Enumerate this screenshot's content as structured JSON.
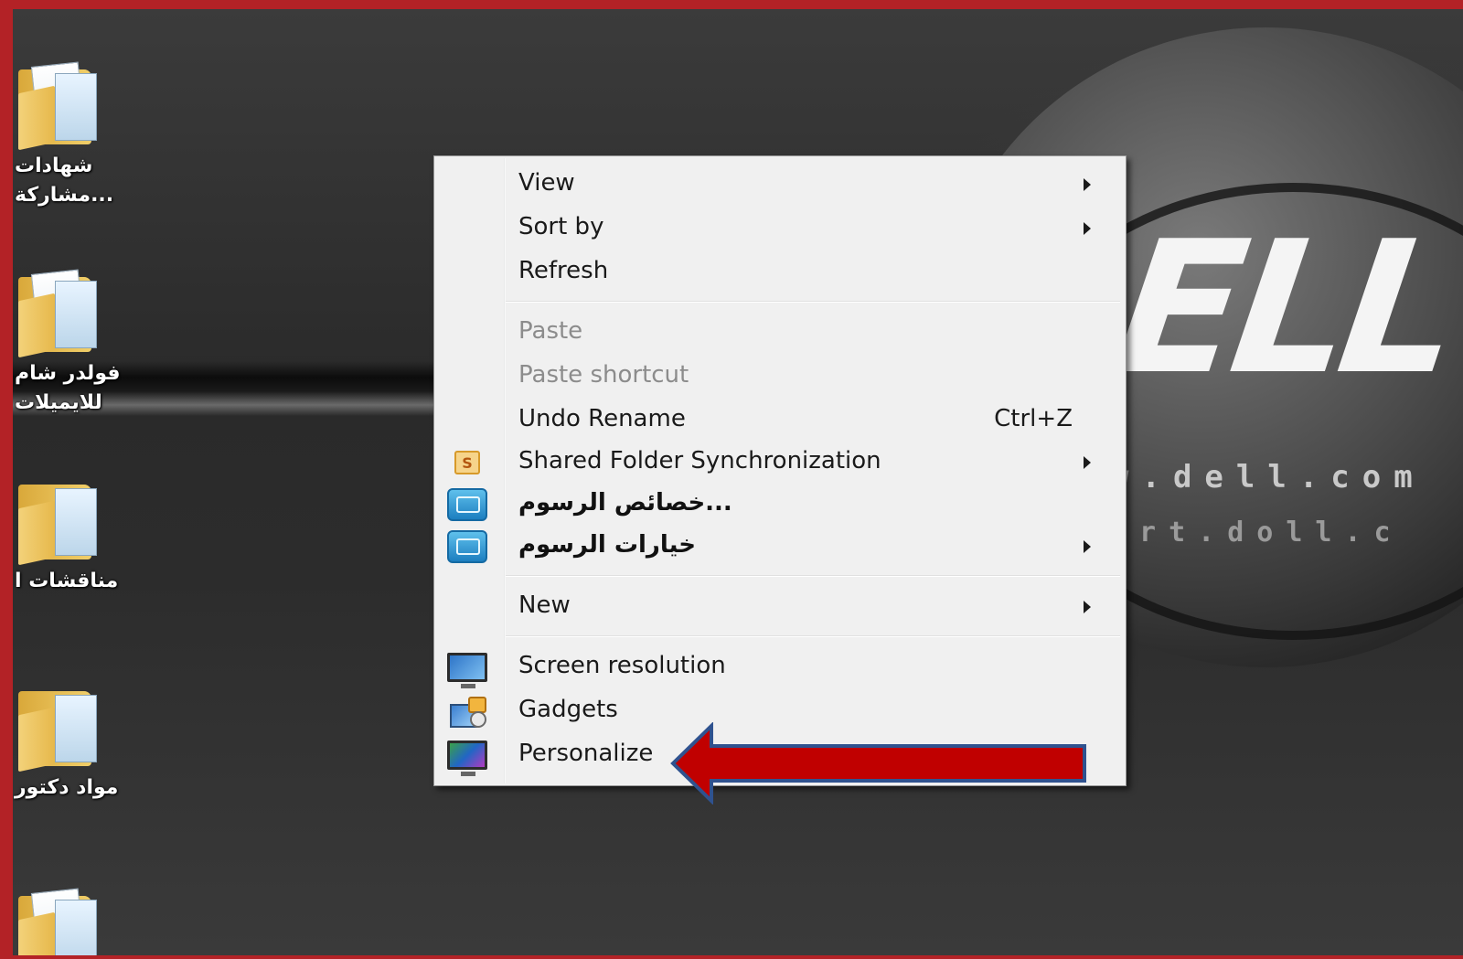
{
  "desktop": {
    "wallpaper": {
      "brand_logo_text": "ELL",
      "url_line_1": "w.dell.com",
      "url_line_2": "ort.doll.c"
    },
    "icons": [
      {
        "label": "شهادات\n...مشاركة"
      },
      {
        "label": "فولدر شام\nللايميلات"
      },
      {
        "label": "مناقشات ا"
      },
      {
        "label": "مواد دكتور"
      }
    ]
  },
  "context_menu": {
    "items": {
      "view": {
        "label": "View",
        "submenu": true
      },
      "sort_by": {
        "label": "Sort by",
        "submenu": true
      },
      "refresh": {
        "label": "Refresh"
      },
      "paste": {
        "label": "Paste",
        "disabled": true
      },
      "paste_shortcut": {
        "label": "Paste shortcut",
        "disabled": true
      },
      "undo_rename": {
        "label": "Undo Rename",
        "shortcut": "Ctrl+Z"
      },
      "shared_folder_sync": {
        "label": "Shared Folder Synchronization",
        "icon": "s-icon",
        "submenu": true
      },
      "graphics_properties": {
        "label": "...خصائص الرسوم",
        "icon": "graphics-icon"
      },
      "graphics_options": {
        "label": "خيارات الرسوم",
        "icon": "graphics-icon",
        "submenu": true
      },
      "new": {
        "label": "New",
        "submenu": true
      },
      "screen_resolution": {
        "label": "Screen resolution",
        "icon": "monitor-icon"
      },
      "gadgets": {
        "label": "Gadgets",
        "icon": "gadgets-icon"
      },
      "personalize": {
        "label": "Personalize",
        "icon": "personalize-icon"
      }
    }
  },
  "annotation": {
    "arrow_color": "#c00000",
    "arrow_outline": "#2f528f",
    "points_to": "personalize"
  },
  "colors": {
    "frame": "#b32226",
    "menu_bg": "#f0f0f0",
    "disabled_text": "#8c8c8c"
  }
}
